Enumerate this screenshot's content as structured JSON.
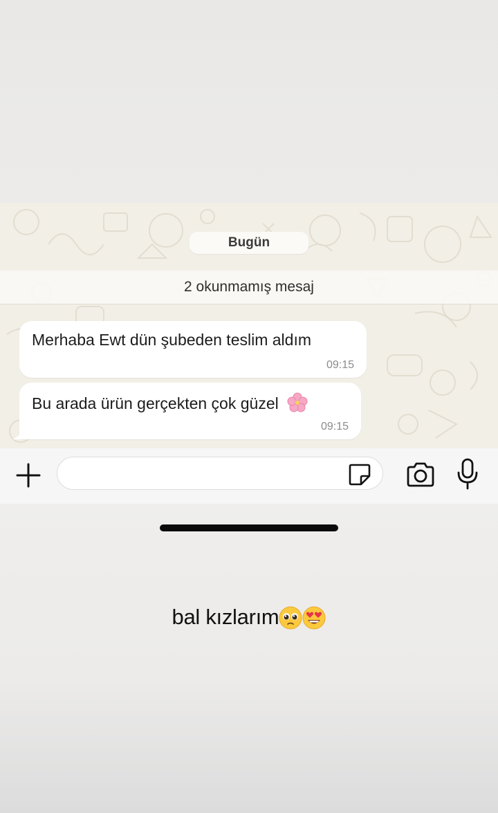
{
  "chat": {
    "date_label": "Bugün",
    "unread_label": "2 okunmamış mesaj",
    "messages": [
      {
        "text": "Merhaba Ewt dün şubeden teslim aldım",
        "time": "09:15"
      },
      {
        "text": "Bu arada ürün gerçekten çok güzel",
        "time": "09:15",
        "emoji": "cherry-blossom"
      }
    ],
    "wallpaper_color": "#f2efe7",
    "bubble_color": "#ffffff"
  },
  "input_bar": {
    "value": "",
    "placeholder": "",
    "icons": [
      "plus-icon",
      "sticker-icon",
      "camera-icon",
      "microphone-icon"
    ]
  },
  "story": {
    "caption": "bal kızlarım",
    "caption_emojis": [
      "pleading-face",
      "heart-eyes-face"
    ]
  }
}
